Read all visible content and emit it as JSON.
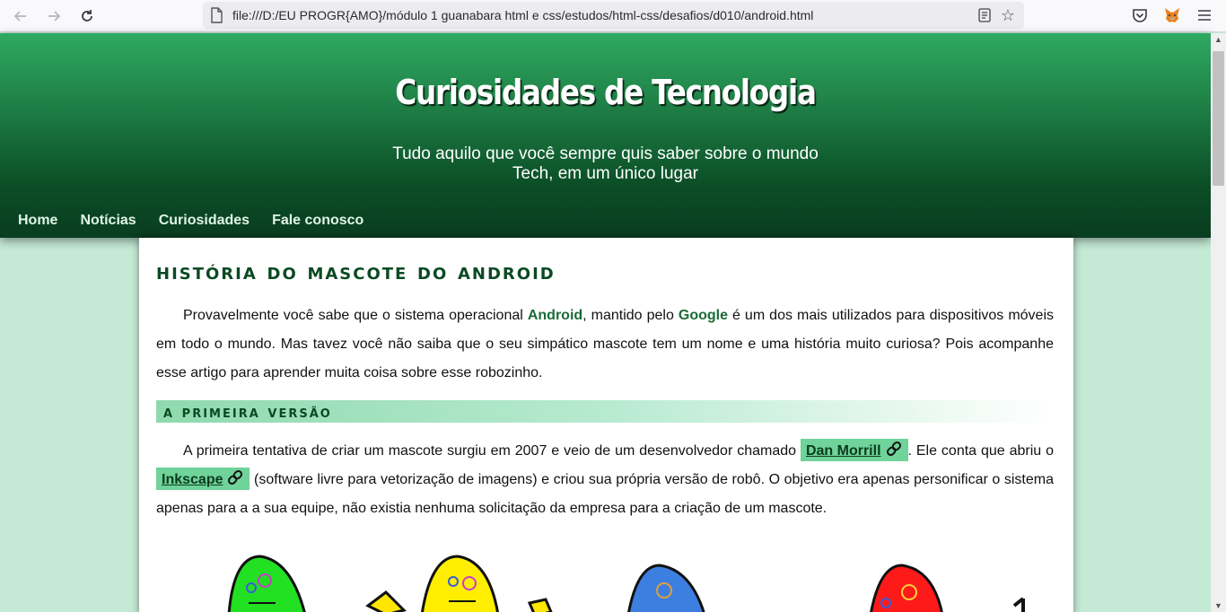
{
  "browser": {
    "url": "file:///D:/EU PROGR{AMO}/módulo 1 guanabara html e css/estudos/html-css/desafios/d010/android.html",
    "icons": [
      "back-arrow-icon",
      "forward-arrow-icon",
      "reload-icon",
      "file-icon",
      "reader-view-icon",
      "bookmark-star-icon",
      "pocket-icon",
      "metamask-fox-icon",
      "hamburger-menu-icon"
    ]
  },
  "header": {
    "title": "Curiosidades de Tecnologia",
    "subtitle_line1": "Tudo aquilo que você sempre quis saber sobre o mundo",
    "subtitle_line2": "Tech, em um único lugar"
  },
  "menu": {
    "items": [
      {
        "label": "Home"
      },
      {
        "label": "Notícias"
      },
      {
        "label": "Curiosidades"
      },
      {
        "label": "Fale conosco"
      }
    ]
  },
  "article": {
    "title": "História do Mascote do Android",
    "p1": {
      "t1": "Provavelmente você sabe que o sistema operacional ",
      "android": "Android",
      "t2": ", mantido pelo ",
      "google": "Google",
      "t3": " é um dos mais utilizados para dispositivos móveis em todo o mundo. Mas tavez você não saiba que o seu simpático mascote tem um nome e uma história muito curiosa? Pois acompanhe esse artigo para aprender muita coisa sobre esse robozinho."
    },
    "section1": {
      "title": "A primeira versão"
    },
    "p2": {
      "t1": "A primeira tentativa de criar um mascote surgiu em 2007 e veio de um desenvolvedor chamado ",
      "link1": "Dan Morrill",
      "t2": ". Ele conta que abriu o ",
      "link2": "Inkscape",
      "t3": " (software livre para vetorização de imagens) e criou sua própria versão de robô. O objetivo era apenas personificar o sistema apenas para a a sua equipe, não existia nenhuma solicitação da empresa para a criação de um mascote."
    }
  },
  "colors": {
    "header_top": "#2fa962",
    "header_bottom": "#0a3d1f",
    "page_bg": "#c4e9d5",
    "title_green": "#0a4a22",
    "highlight_green": "#6fd39a"
  }
}
